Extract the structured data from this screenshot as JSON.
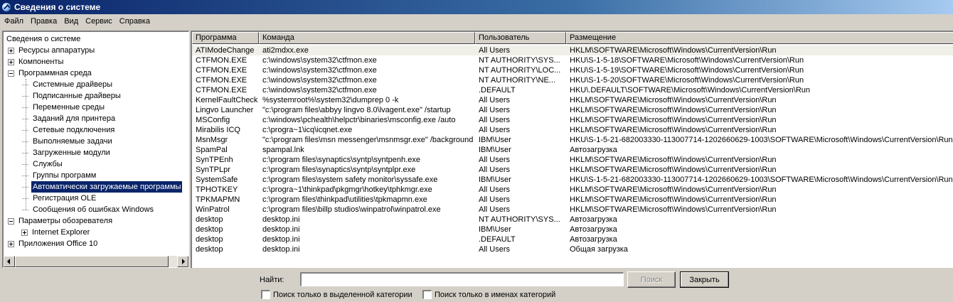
{
  "window": {
    "title": "Сведения о системе"
  },
  "menu": [
    "Файл",
    "Правка",
    "Вид",
    "Сервис",
    "Справка"
  ],
  "tree": {
    "root": "Сведения о системе",
    "items": [
      {
        "label": "Ресурсы аппаратуры",
        "level": 1,
        "expander": "plus"
      },
      {
        "label": "Компоненты",
        "level": 1,
        "expander": "plus"
      },
      {
        "label": "Программная среда",
        "level": 1,
        "expander": "minus"
      },
      {
        "label": "Системные драйверы",
        "level": 2
      },
      {
        "label": "Подписанные драйверы",
        "level": 2
      },
      {
        "label": "Переменные среды",
        "level": 2
      },
      {
        "label": "Заданий для принтера",
        "level": 2
      },
      {
        "label": "Сетевые подключения",
        "level": 2
      },
      {
        "label": "Выполняемые задачи",
        "level": 2
      },
      {
        "label": "Загруженные модули",
        "level": 2
      },
      {
        "label": "Службы",
        "level": 2
      },
      {
        "label": "Группы программ",
        "level": 2
      },
      {
        "label": "Автоматически загружаемые программы",
        "level": 2,
        "selected": true
      },
      {
        "label": "Регистрация OLE",
        "level": 2
      },
      {
        "label": "Сообщения об ошибках Windows",
        "level": 2
      },
      {
        "label": "Параметры обозревателя",
        "level": 1,
        "expander": "minus"
      },
      {
        "label": "Internet Explorer",
        "level": 2,
        "expander": "plus"
      },
      {
        "label": "Приложения Office 10",
        "level": 1,
        "expander": "plus"
      }
    ]
  },
  "list": {
    "columns": [
      "Программа",
      "Команда",
      "Пользователь",
      "Размещение"
    ],
    "rows": [
      [
        "ATIModeChange",
        "ati2mdxx.exe",
        "All Users",
        "HKLM\\SOFTWARE\\Microsoft\\Windows\\CurrentVersion\\Run"
      ],
      [
        "CTFMON.EXE",
        "c:\\windows\\system32\\ctfmon.exe",
        "NT AUTHORITY\\SYS...",
        "HKU\\S-1-5-18\\SOFTWARE\\Microsoft\\Windows\\CurrentVersion\\Run"
      ],
      [
        "CTFMON.EXE",
        "c:\\windows\\system32\\ctfmon.exe",
        "NT AUTHORITY\\LOC...",
        "HKU\\S-1-5-19\\SOFTWARE\\Microsoft\\Windows\\CurrentVersion\\Run"
      ],
      [
        "CTFMON.EXE",
        "c:\\windows\\system32\\ctfmon.exe",
        "NT AUTHORITY\\NE...",
        "HKU\\S-1-5-20\\SOFTWARE\\Microsoft\\Windows\\CurrentVersion\\Run"
      ],
      [
        "CTFMON.EXE",
        "c:\\windows\\system32\\ctfmon.exe",
        ".DEFAULT",
        "HKU\\.DEFAULT\\SOFTWARE\\Microsoft\\Windows\\CurrentVersion\\Run"
      ],
      [
        "KernelFaultCheck",
        "%systemroot%\\system32\\dumprep 0 -k",
        "All Users",
        "HKLM\\SOFTWARE\\Microsoft\\Windows\\CurrentVersion\\Run"
      ],
      [
        "Lingvo Launcher",
        "\"c:\\program files\\abbyy lingvo 8.0\\lvagent.exe\" /startup",
        "All Users",
        "HKLM\\SOFTWARE\\Microsoft\\Windows\\CurrentVersion\\Run"
      ],
      [
        "MSConfig",
        "c:\\windows\\pchealth\\helpctr\\binaries\\msconfig.exe /auto",
        "All Users",
        "HKLM\\SOFTWARE\\Microsoft\\Windows\\CurrentVersion\\Run"
      ],
      [
        "Mirabilis ICQ",
        "c:\\progra~1\\icq\\icqnet.exe",
        "All Users",
        "HKLM\\SOFTWARE\\Microsoft\\Windows\\CurrentVersion\\Run"
      ],
      [
        "MsnMsgr",
        "\"c:\\program files\\msn messenger\\msnmsgr.exe\" /background",
        "IBM\\User",
        "HKU\\S-1-5-21-682003330-113007714-1202660629-1003\\SOFTWARE\\Microsoft\\Windows\\CurrentVersion\\Run"
      ],
      [
        "SpamPal",
        "spampal.lnk",
        "IBM\\User",
        "Автозагрузка"
      ],
      [
        "SynTPEnh",
        "c:\\program files\\synaptics\\syntp\\syntpenh.exe",
        "All Users",
        "HKLM\\SOFTWARE\\Microsoft\\Windows\\CurrentVersion\\Run"
      ],
      [
        "SynTPLpr",
        "c:\\program files\\synaptics\\syntp\\syntplpr.exe",
        "All Users",
        "HKLM\\SOFTWARE\\Microsoft\\Windows\\CurrentVersion\\Run"
      ],
      [
        "SystemSafe",
        "c:\\program files\\system safety monitor\\syssafe.exe",
        "IBM\\User",
        "HKU\\S-1-5-21-682003330-113007714-1202660629-1003\\SOFTWARE\\Microsoft\\Windows\\CurrentVersion\\Run"
      ],
      [
        "TPHOTKEY",
        "c:\\progra~1\\thinkpad\\pkgmgr\\hotkey\\tphkmgr.exe",
        "All Users",
        "HKLM\\SOFTWARE\\Microsoft\\Windows\\CurrentVersion\\Run"
      ],
      [
        "TPKMAPMN",
        "c:\\program files\\thinkpad\\utilities\\tpkmapmn.exe",
        "All Users",
        "HKLM\\SOFTWARE\\Microsoft\\Windows\\CurrentVersion\\Run"
      ],
      [
        "WinPatrol",
        "c:\\program files\\billp studios\\winpatrol\\winpatrol.exe",
        "All Users",
        "HKLM\\SOFTWARE\\Microsoft\\Windows\\CurrentVersion\\Run"
      ],
      [
        "desktop",
        "desktop.ini",
        "NT AUTHORITY\\SYS...",
        "Автозагрузка"
      ],
      [
        "desktop",
        "desktop.ini",
        "IBM\\User",
        "Автозагрузка"
      ],
      [
        "desktop",
        "desktop.ini",
        ".DEFAULT",
        "Автозагрузка"
      ],
      [
        "desktop",
        "desktop.ini",
        "All Users",
        "Общая загрузка"
      ]
    ]
  },
  "search": {
    "label": "Найти:",
    "value": "",
    "search_button": "Поиск",
    "close_button": "Закрыть",
    "option_selected_category": "Поиск только в выделенной категории",
    "option_category_names": "Поиск только в именах категорий"
  },
  "colors": {
    "selection": "#0a246a",
    "face": "#d4d0c8"
  }
}
